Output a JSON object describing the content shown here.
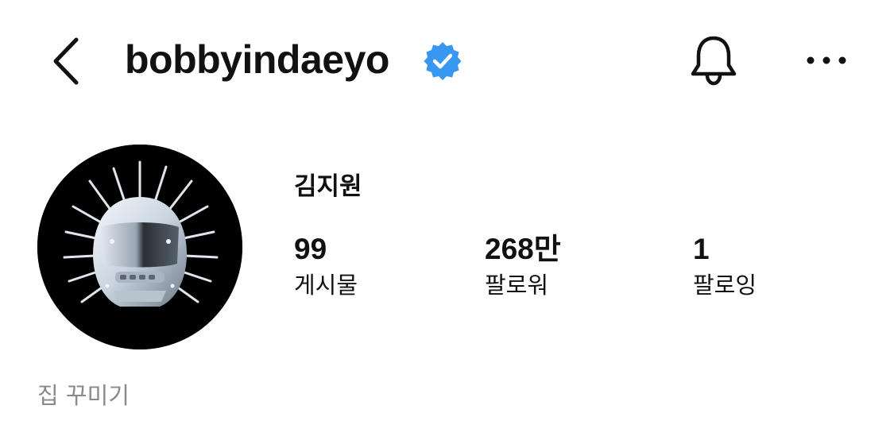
{
  "header": {
    "back_icon": "chevron-left-icon",
    "username": "bobbyindaeyo",
    "verified_icon": "verified-badge-icon",
    "verified_color": "#3897f0",
    "notifications_icon": "bell-icon",
    "more_icon": "more-horizontal-icon"
  },
  "profile": {
    "avatar_description_icon": "avatar-helmet-image",
    "display_name": "김지원",
    "stats": {
      "posts": {
        "value": "99",
        "label": "게시물"
      },
      "followers": {
        "value": "268만",
        "label": "팔로워"
      },
      "following": {
        "value": "1",
        "label": "팔로잉"
      }
    },
    "decorate_label": "집 꾸미기"
  }
}
